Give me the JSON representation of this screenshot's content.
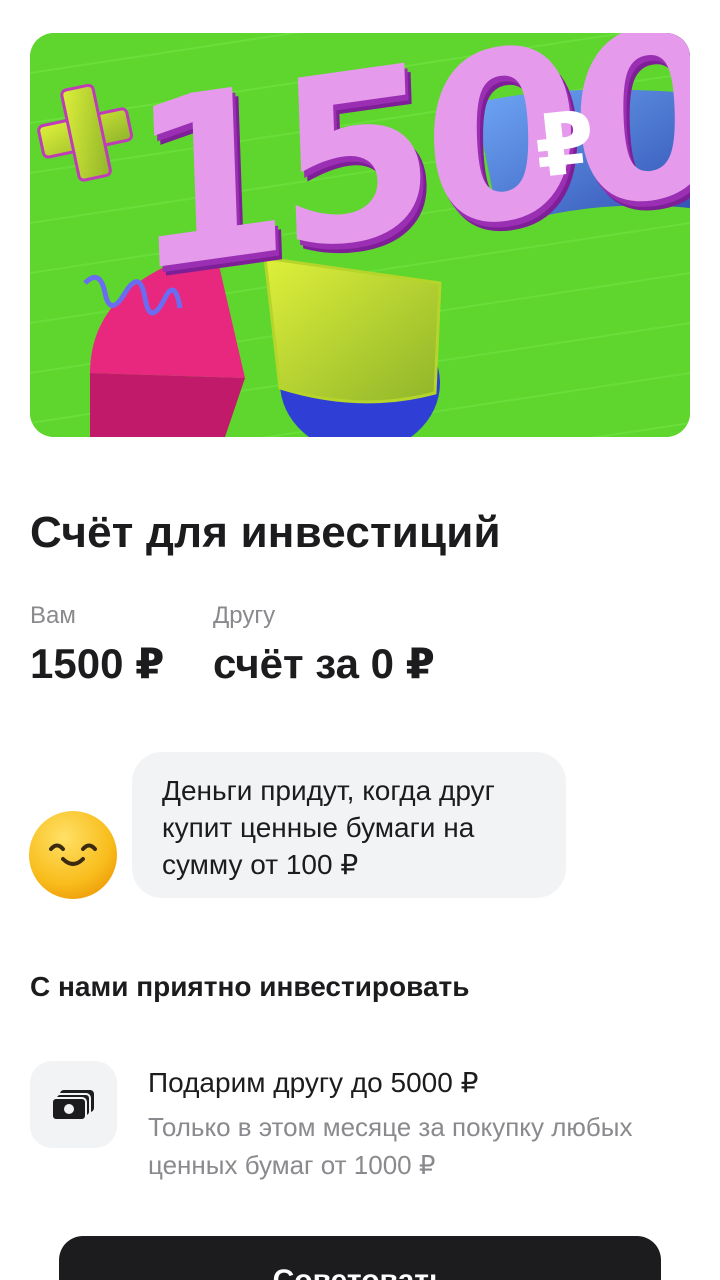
{
  "banner": {
    "prefix": "+",
    "amount": "1500",
    "currency_symbol": "₽",
    "colors": {
      "background": "#5ed62e",
      "digits": "#e08be8",
      "plus": "#e7f23a",
      "flag": "#4f82e0"
    }
  },
  "title": "Счёт для инвестиций",
  "rewards": {
    "you": {
      "label": "Вам",
      "value": "1500 ₽"
    },
    "friend": {
      "label": "Другу",
      "value": "счёт за 0 ₽"
    }
  },
  "hint": {
    "avatar_icon": "smiley-face-icon",
    "text": "Деньги придут, когда друг купит ценные бумаги на сумму от 100 ₽"
  },
  "section": {
    "title": "С нами приятно инвестировать"
  },
  "feature": {
    "icon": "banknotes-icon",
    "title": "Подарим другу до 5000 ₽",
    "description": "Только в этом месяце за покупку любых ценных бумаг от 1000 ₽"
  },
  "cta": {
    "label": "Советовать"
  }
}
